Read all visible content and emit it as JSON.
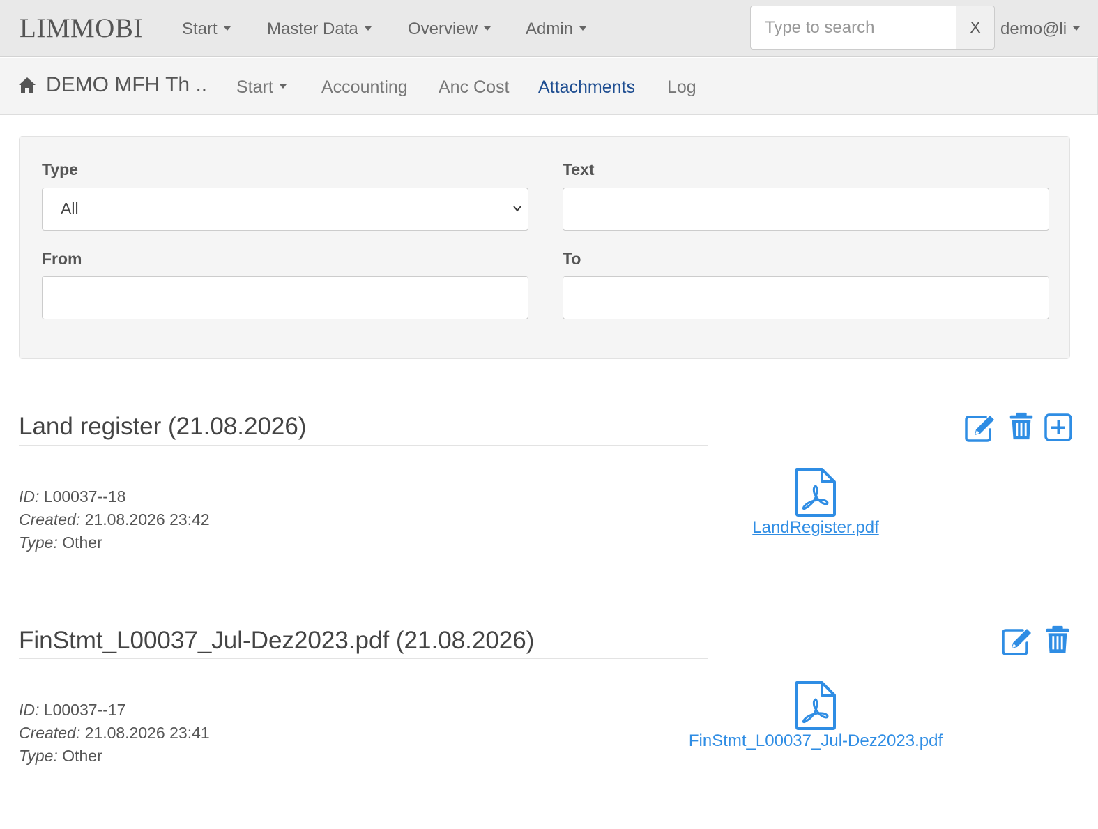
{
  "topnav": {
    "brand": "LIMMOBI",
    "menus": [
      "Start",
      "Master Data",
      "Overview",
      "Admin"
    ],
    "search_placeholder": "Type to search",
    "search_clear": "X",
    "user": "demo@li"
  },
  "subnav": {
    "property": "DEMO MFH Th ..",
    "start": "Start",
    "accounting": "Accounting",
    "anc_cost": "Anc Cost",
    "attachments": "Attachments",
    "log": "Log"
  },
  "filters": {
    "type_label": "Type",
    "type_value": "All",
    "text_label": "Text",
    "text_value": "",
    "from_label": "From",
    "from_value": "",
    "to_label": "To",
    "to_value": ""
  },
  "meta_labels": {
    "id": "ID:",
    "created": "Created:",
    "type": "Type:"
  },
  "attachments": [
    {
      "title": "Land register (21.08.2026)",
      "id": "L00037--18",
      "created": "21.08.2026 23:42",
      "type": "Other",
      "file": "LandRegister.pdf",
      "actions": [
        "edit-icon",
        "trash-icon",
        "add-icon"
      ]
    },
    {
      "title": "FinStmt_L00037_Jul-Dez2023.pdf (21.08.2026)",
      "id": "L00037--17",
      "created": "21.08.2026 23:41",
      "type": "Other",
      "file": "FinStmt_L00037_Jul-Dez2023.pdf",
      "actions": [
        "edit-icon",
        "trash-icon"
      ]
    }
  ],
  "colors": {
    "accent": "#2f8de4",
    "active_nav": "#1f4e91",
    "topbar": "#e9e9e9"
  }
}
